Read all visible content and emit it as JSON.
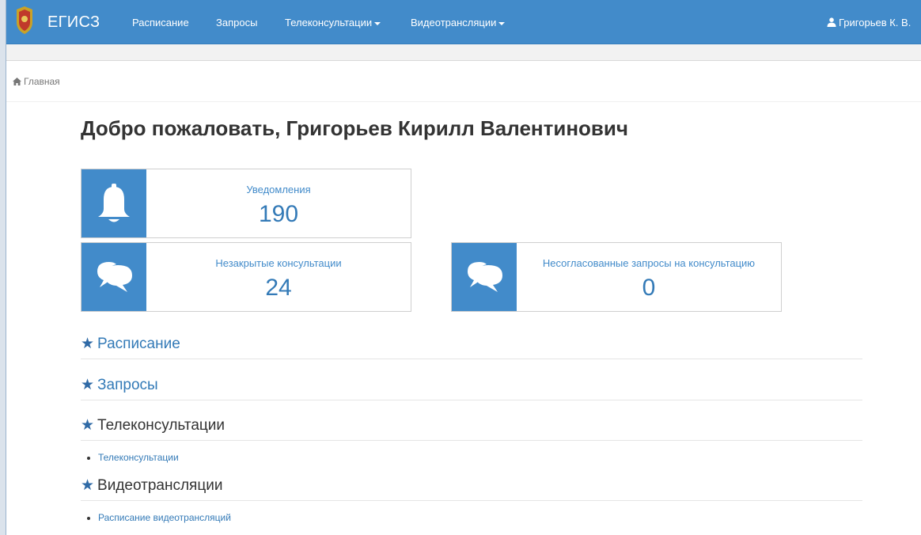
{
  "navbar": {
    "brand": "ЕГИСЗ",
    "items": [
      {
        "label": "Расписание",
        "dropdown": false
      },
      {
        "label": "Запросы",
        "dropdown": false
      },
      {
        "label": "Телеконсультации",
        "dropdown": true
      },
      {
        "label": "Видеотрансляции",
        "dropdown": true
      }
    ],
    "user": "Григорьев К. В."
  },
  "breadcrumb": {
    "home": "Главная"
  },
  "welcome": "Добро пожаловать, Григорьев Кирилл Валентинович",
  "cards": [
    {
      "icon": "bell-icon",
      "label": "Уведомления",
      "value": "190"
    },
    {
      "icon": "chat-bubbles-icon",
      "label": "Незакрытые консультации",
      "value": "24"
    },
    {
      "icon": "chat-bubbles-icon",
      "label": "Несогласованные запросы на консультацию",
      "value": "0"
    }
  ],
  "sections": [
    {
      "title": "Расписание",
      "style": "link",
      "items": []
    },
    {
      "title": "Запросы",
      "style": "link",
      "items": []
    },
    {
      "title": "Телеконсультации",
      "style": "plain",
      "items": [
        "Телеконсультации"
      ]
    },
    {
      "title": "Видеотрансляции",
      "style": "plain",
      "items": [
        "Расписание видеотрансляций"
      ]
    }
  ],
  "colors": {
    "navbar": "#428bca",
    "link": "#337ab7",
    "icon_box": "#428bca"
  }
}
